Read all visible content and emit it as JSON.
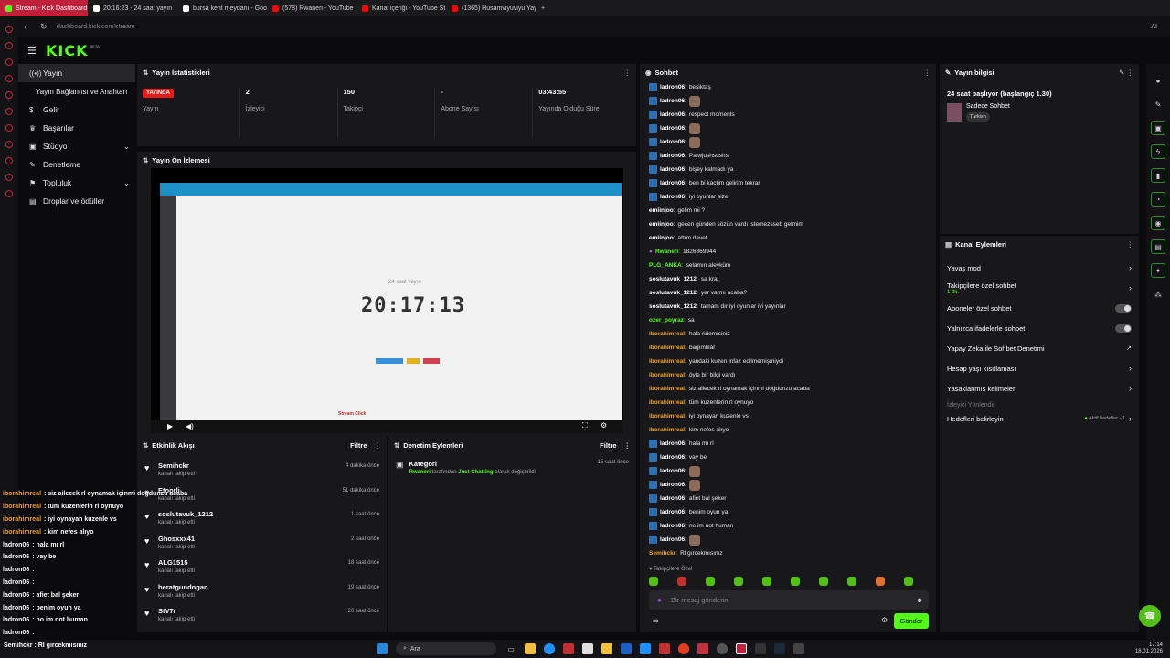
{
  "browser": {
    "tabs": [
      {
        "label": "Stream - Kick Dashboard",
        "color": "#53fc18",
        "active": true
      },
      {
        "label": "20:16:23 - 24 saat yayın",
        "color": "#ffffff"
      },
      {
        "label": "bursa kent meydanı - Goo",
        "color": "#ffffff"
      },
      {
        "label": "(578) Rwaneri - YouTube",
        "color": "#ff0000"
      },
      {
        "label": "Kanal içeriği - YouTube St",
        "color": "#ff0000"
      },
      {
        "label": "(1365) Husamviyuviyu Yay",
        "color": "#ff0000"
      }
    ],
    "url": "dashboard.kick.com/stream",
    "ai_label": "AI"
  },
  "header": {
    "logo": "KICK",
    "logo_sup": "BETA"
  },
  "sidebar": {
    "items": [
      {
        "icon": "((•))",
        "label": "Yayın",
        "active": true
      },
      {
        "icon": "",
        "label": "Yayın Bağlantısı ve Anahtarı"
      },
      {
        "icon": "$",
        "label": "Gelir"
      },
      {
        "icon": "♛",
        "label": "Başarılar"
      },
      {
        "icon": "▣",
        "label": "Stüdyo",
        "chev": "⌄"
      },
      {
        "icon": "✎",
        "label": "Denetleme"
      },
      {
        "icon": "⚑",
        "label": "Topluluk",
        "chev": "⌄"
      },
      {
        "icon": "▤",
        "label": "Droplar ve ödüller"
      }
    ]
  },
  "stats": {
    "title": "Yayın İstatistikleri",
    "items": [
      {
        "value": "YAYINDA",
        "label": "Yayın",
        "badge": true
      },
      {
        "value": "2",
        "label": "İzleyici"
      },
      {
        "value": "150",
        "label": "Takipçi"
      },
      {
        "value": "-",
        "label": "Abone Sayısı"
      },
      {
        "value": "03:43:55",
        "label": "Yayında Olduğu Süre"
      }
    ]
  },
  "preview": {
    "title": "Yayın Ön İzlemesi",
    "inner_label": "24 saat yayın",
    "clock": "20:17:13",
    "sub_label": "Stream Click"
  },
  "activity": {
    "title": "Etkinlik Akışı",
    "filter": "Filtre",
    "rows": [
      {
        "name": "Semihckr",
        "sub": "kanalı takip etti",
        "time": "4 dakika önce"
      },
      {
        "name": "Etoorli",
        "sub": "kanalı takip etti",
        "time": "51 dakika önce"
      },
      {
        "name": "soslutavuk_1212",
        "sub": "kanalı takip etti",
        "time": "1 saat önce"
      },
      {
        "name": "Ghosxxx41",
        "sub": "kanalı takip etti",
        "time": "2 saat önce"
      },
      {
        "name": "ALG1515",
        "sub": "kanalı takip etti",
        "time": "18 saat önce"
      },
      {
        "name": "beratgundogan",
        "sub": "kanalı takip etti",
        "time": "19 saat önce"
      },
      {
        "name": "StV7r",
        "sub": "kanalı takip etti",
        "time": "20 saat önce"
      }
    ]
  },
  "moderation": {
    "title": "Denetim Eylemleri",
    "filter": "Filtre",
    "item_title": "Kategori",
    "item_user": "Rwaneri",
    "item_mid": "tarafından",
    "item_cat": "Just Chatting",
    "item_end": "olarak değiştirildi",
    "item_time": "15 saat önce"
  },
  "chat": {
    "title": "Sohbet",
    "lines": [
      {
        "user": "ladron06",
        "color": "#ffffff",
        "text": "beşiktaş",
        "badge": true
      },
      {
        "user": "ladron06",
        "color": "#ffffff",
        "text": "",
        "badge": true,
        "emote": true
      },
      {
        "user": "ladron06",
        "color": "#ffffff",
        "text": "respect moments",
        "badge": true
      },
      {
        "user": "ladron06",
        "color": "#ffffff",
        "text": "",
        "badge": true,
        "emote": true
      },
      {
        "user": "ladron06",
        "color": "#ffffff",
        "text": "",
        "badge": true,
        "emote": true
      },
      {
        "user": "ladron06",
        "color": "#ffffff",
        "text": "Pajwjushsushs",
        "badge": true
      },
      {
        "user": "ladron06",
        "color": "#ffffff",
        "text": "bişey kalmadı ya",
        "badge": true
      },
      {
        "user": "ladron06",
        "color": "#ffffff",
        "text": "ben bi kactim gelirim tekrar",
        "badge": true
      },
      {
        "user": "ladron06",
        "color": "#ffffff",
        "text": "iyi oyunlar size",
        "badge": true
      },
      {
        "user": "emiinjoo",
        "color": "#ffffff",
        "text": "gelim mi ?"
      },
      {
        "user": "emiinjoo",
        "color": "#ffffff",
        "text": "geçen günden sözün vardı istemezsseb gelmim"
      },
      {
        "user": "emiinjoo",
        "color": "#ffffff",
        "text": "attım davet"
      },
      {
        "user": "Rwaneri",
        "color": "#53fc18",
        "text": "1826369944",
        "mic": true
      },
      {
        "user": "PLG_ANKA",
        "color": "#53fc18",
        "text": "selamın aleyküm"
      },
      {
        "user": "soslutavuk_1212",
        "color": "#ffffff",
        "text": "sa kral"
      },
      {
        "user": "soslutavuk_1212",
        "color": "#ffffff",
        "text": "yer varmı acaba?"
      },
      {
        "user": "soslutavuk_1212",
        "color": "#ffffff",
        "text": "tamam dır iyi oyunlar iyi yayınlar"
      },
      {
        "user": "ozer_poyraz",
        "color": "#53fc18",
        "text": "sa"
      },
      {
        "user": "iborahimreal",
        "color": "#f0a020",
        "text": "hala ridemisiniz"
      },
      {
        "user": "iborahimreal",
        "color": "#f0a020",
        "text": "bağımlılar"
      },
      {
        "user": "iborahimreal",
        "color": "#f0a020",
        "text": "yandaki kuzen infaz edilmemişmiydi"
      },
      {
        "user": "iborahimreal",
        "color": "#f0a020",
        "text": "öyle bir bilgi vardı"
      },
      {
        "user": "iborahimreal",
        "color": "#f0a020",
        "text": "siz ailecek rl oynamak içinmi doğdunzu acaba"
      },
      {
        "user": "iborahimreal",
        "color": "#f0a020",
        "text": "tüm kuzenlerin rl oynuyo"
      },
      {
        "user": "iborahimreal",
        "color": "#f0a020",
        "text": "iyi oynayan kuzenle vs"
      },
      {
        "user": "iborahimreal",
        "color": "#f0a020",
        "text": "kim nefes alıyo"
      },
      {
        "user": "ladron06",
        "color": "#ffffff",
        "text": "hala mı rl",
        "badge": true
      },
      {
        "user": "ladron06",
        "color": "#ffffff",
        "text": "vay be",
        "badge": true
      },
      {
        "user": "ladron06",
        "color": "#ffffff",
        "text": "",
        "badge": true,
        "emote": true
      },
      {
        "user": "ladron06",
        "color": "#ffffff",
        "text": "",
        "badge": true,
        "emote": true
      },
      {
        "user": "ladron06",
        "color": "#ffffff",
        "text": "afiet bal şeker",
        "badge": true
      },
      {
        "user": "ladron06",
        "color": "#ffffff",
        "text": "benim oyun ya",
        "badge": true
      },
      {
        "user": "ladron06",
        "color": "#ffffff",
        "text": "no im not human",
        "badge": true
      },
      {
        "user": "ladron06",
        "color": "#ffffff",
        "text": "",
        "badge": true,
        "emote": true
      },
      {
        "user": "Semihckr",
        "color": "#f0a020",
        "text": "Rl gırcekmısınız"
      }
    ],
    "followers_label": "Takipçilere Özel",
    "input_placeholder": "Bir mesaj gönderin",
    "send_label": "Gönder",
    "infinity": "∞"
  },
  "stream_info": {
    "title": "Yayın bilgisi",
    "stream_title": "24 saat başlıyor (başlangıç 1.30)",
    "category": "Sadece Sohbet",
    "language": "Turkish"
  },
  "channel_actions": {
    "title": "Kanal Eylemleri",
    "rows": [
      {
        "label": "Yavaş mod",
        "type": "arrow"
      },
      {
        "label": "Takipçilere özel sohbet",
        "sub": "1 dk.",
        "type": "arrow"
      },
      {
        "label": "Aboneler özel sohbet",
        "type": "toggle"
      },
      {
        "label": "Yalnızca ifadelerle sohbet",
        "type": "toggle"
      },
      {
        "label": "Yapay Zeka ile Sohbet Denetimi",
        "type": "ext"
      },
      {
        "label": "Hesap yaşı kısıtlaması",
        "type": "arrow"
      },
      {
        "label": "Yasaklanmış kelimeler",
        "type": "arrow"
      }
    ],
    "section": "İzleyici Yönlendir",
    "goals_label": "Hedefleri belirleyin",
    "goals_value": "Aktif hedefler - 1"
  },
  "overlay_chat": [
    {
      "user": "iborahimreal",
      "color": "#f0a020",
      "text": ": siz ailecek rl oynamak içinmi doğdunzu acaba"
    },
    {
      "user": "iborahimreal",
      "color": "#f0a020",
      "text": ": tüm kuzenlerin rl oynuyo"
    },
    {
      "user": "iborahimreal",
      "color": "#f0a020",
      "text": ": iyi oynayan kuzenle vs"
    },
    {
      "user": "iborahimreal",
      "color": "#f0a020",
      "text": ": kim nefes alıyo"
    },
    {
      "user": "ladron06",
      "color": "#ffffff",
      "text": ": hala mı rl"
    },
    {
      "user": "ladron06",
      "color": "#ffffff",
      "text": ": vay be"
    },
    {
      "user": "ladron06",
      "color": "#ffffff",
      "text": ":"
    },
    {
      "user": "ladron06",
      "color": "#ffffff",
      "text": ":"
    },
    {
      "user": "ladron06",
      "color": "#ffffff",
      "text": ": afiet bal şeker"
    },
    {
      "user": "ladron06",
      "color": "#ffffff",
      "text": ": benim oyun ya"
    },
    {
      "user": "ladron06",
      "color": "#ffffff",
      "text": ": no im not human"
    },
    {
      "user": "ladron06",
      "color": "#ffffff",
      "text": ":"
    }
  ],
  "overlay_last": "Semihckr : Rl gırcekmısınız",
  "taskbar": {
    "search": "Ara",
    "time": "17:14",
    "date": "18.01.2026"
  }
}
